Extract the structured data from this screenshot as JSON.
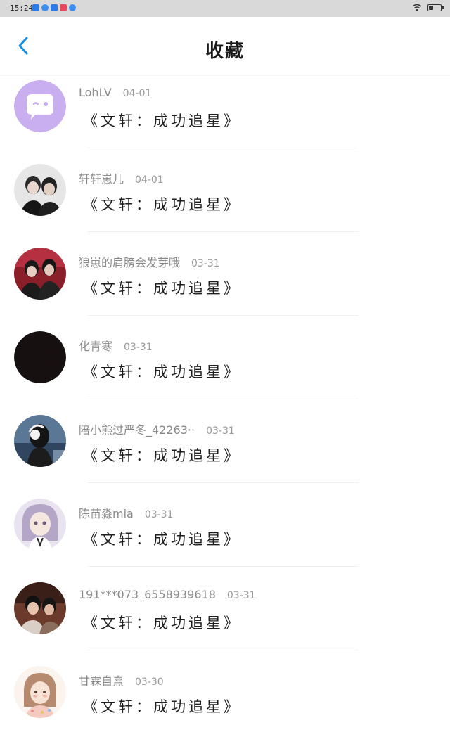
{
  "status_bar": {
    "time": "15:24"
  },
  "nav": {
    "title": "收藏"
  },
  "colors": {
    "accent": "#1a8fe8",
    "text": "#1e1e1e",
    "muted": "#8a8a8a"
  },
  "items": [
    {
      "user": "LohLV",
      "date": "04-01",
      "title": "《文轩：成功追星》",
      "avatar": "chat-bubble-icon"
    },
    {
      "user": "轩轩崽儿",
      "date": "04-01",
      "title": "《文轩：成功追星》",
      "avatar": "two-people-photo"
    },
    {
      "user": "狼崽的肩膀会发芽哦",
      "date": "03-31",
      "title": "《文轩：成功追星》",
      "avatar": "two-people-red-photo"
    },
    {
      "user": "化青寒",
      "date": "03-31",
      "title": "《文轩：成功追星》",
      "avatar": "black-circle"
    },
    {
      "user": "陪小熊过严冬_42263··",
      "date": "03-31",
      "title": "《文轩：成功追星》",
      "avatar": "headphone-girl-photo"
    },
    {
      "user": "陈苗淼mia",
      "date": "03-31",
      "title": "《文轩：成功追星》",
      "avatar": "anime-girl-illustration"
    },
    {
      "user": "191***073_6558939618",
      "date": "03-31",
      "title": "《文轩：成功追星》",
      "avatar": "two-people-warm-photo"
    },
    {
      "user": "甘霖自熹",
      "date": "03-30",
      "title": "《文轩：成功追星》",
      "avatar": "cartoon-girl-illustration"
    }
  ]
}
